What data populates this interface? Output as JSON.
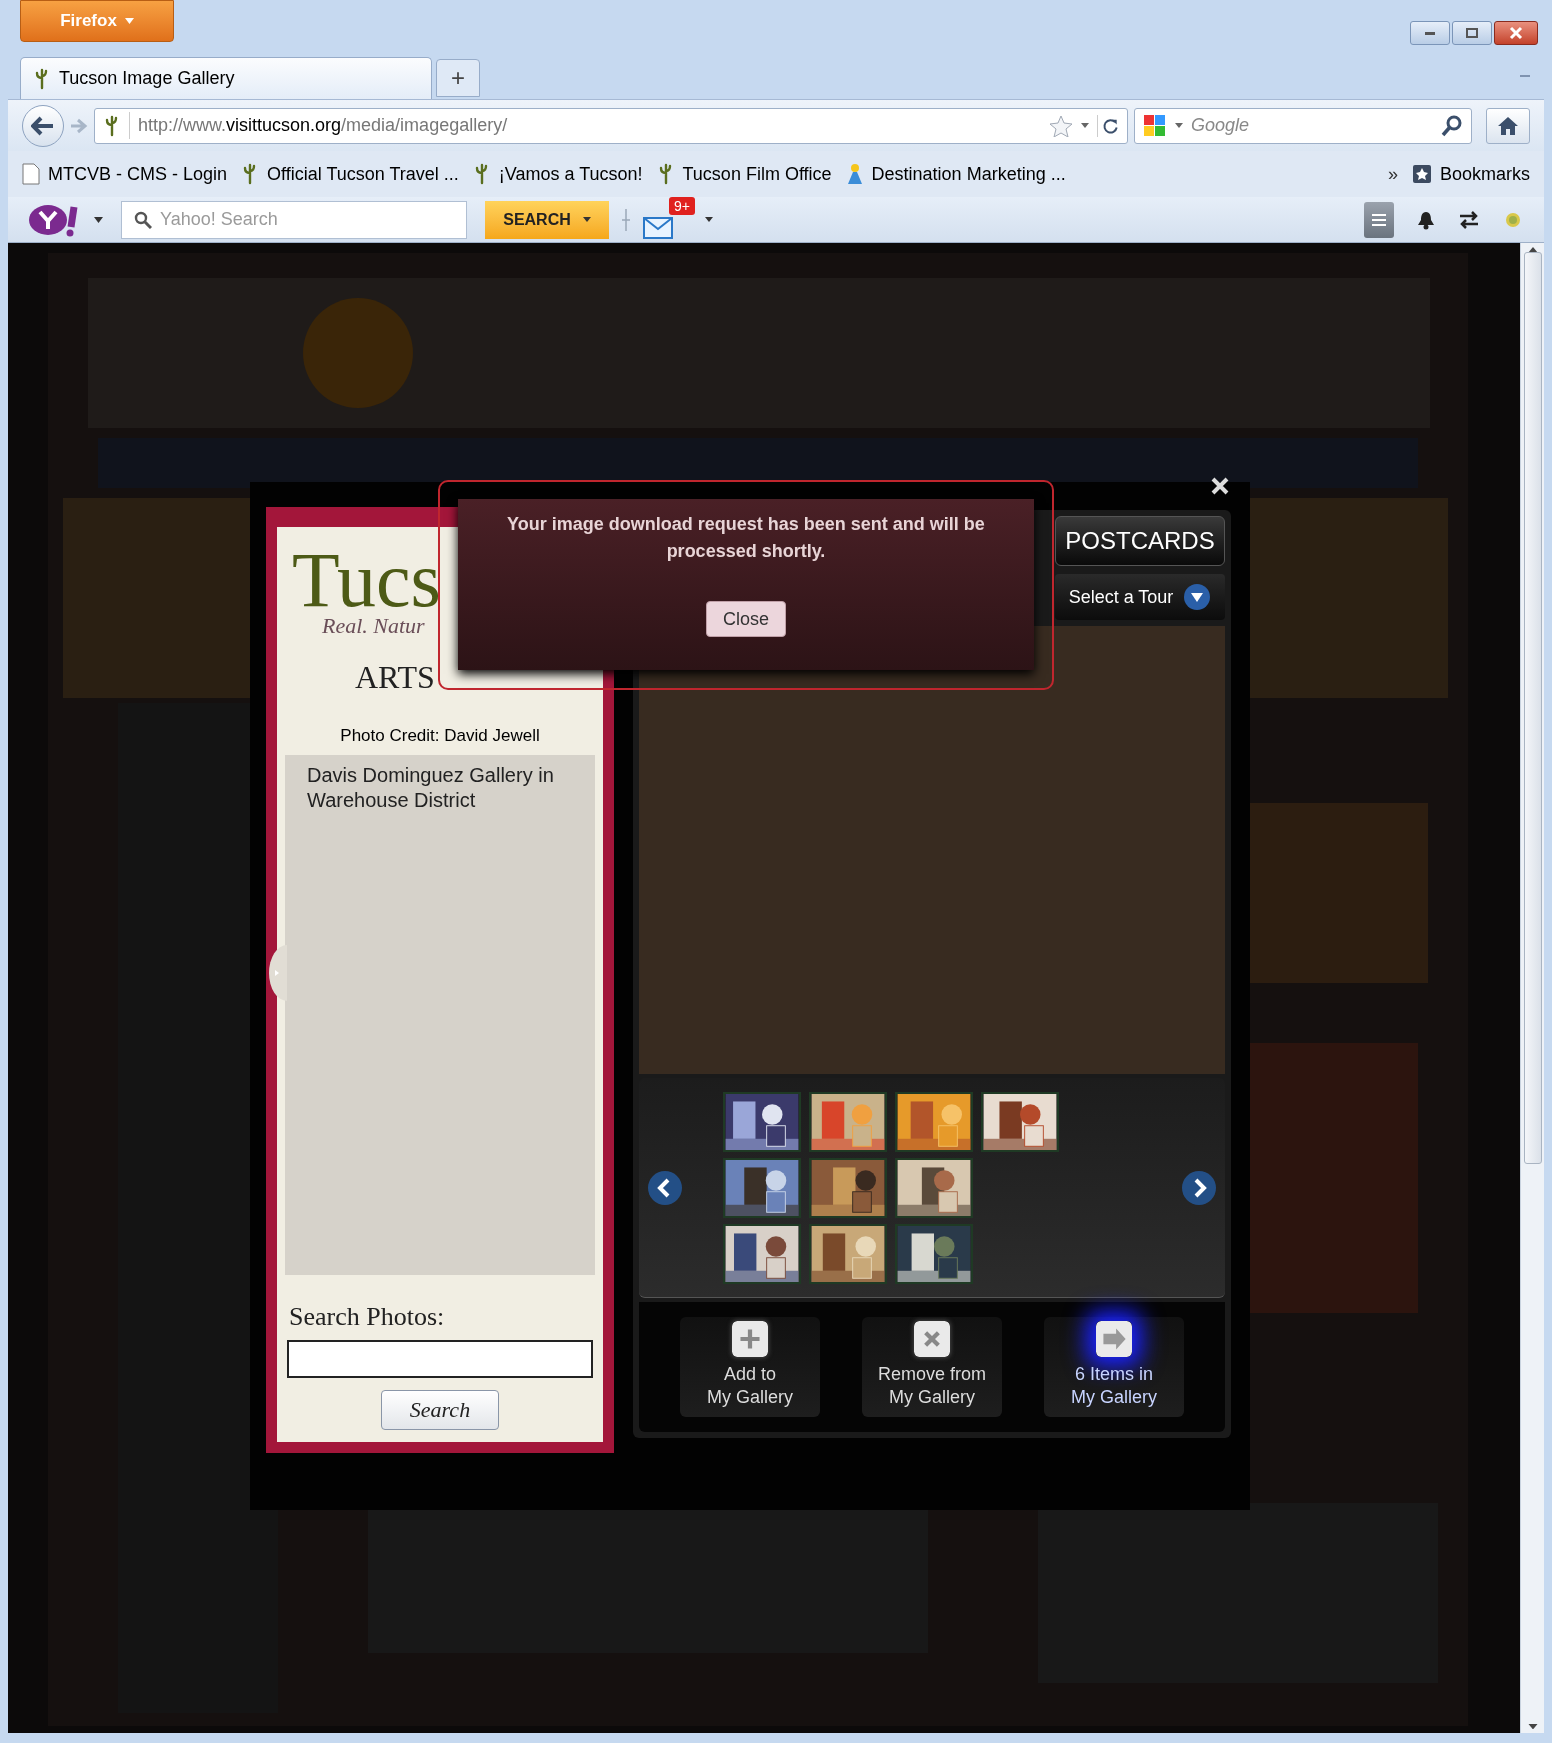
{
  "browser": {
    "menu_button": "Firefox",
    "tabs": [
      {
        "title": "Tucson Image Gallery",
        "selected": true
      }
    ],
    "new_tab": "+",
    "url": {
      "prefix": "http://www.",
      "domain": "visittucson.org",
      "path": "/media/imagegallery/"
    },
    "search_placeholder": "Google",
    "bookmarks": [
      {
        "label": "MTCVB - CMS - Login",
        "kind": "page"
      },
      {
        "label": "Official Tucson Travel ...",
        "kind": "cactus"
      },
      {
        "label": "¡Vamos a Tucson!",
        "kind": "cactus"
      },
      {
        "label": "Tucson Film Office",
        "kind": "cactus"
      },
      {
        "label": "Destination Marketing ...",
        "kind": "figure"
      }
    ],
    "overflow": "»",
    "bookmarks_menu": "Bookmarks"
  },
  "yahoo_toolbar": {
    "search_placeholder": "Yahoo! Search",
    "search_button": "SEARCH",
    "mail_badge": "9+"
  },
  "gallery": {
    "logo": "Tucs",
    "logo_tagline": "Real. Natur",
    "category": "ARTS",
    "photo_credit": "Photo Credit: David Jewell",
    "caption": "Davis Dominguez Gallery in Warehouse District",
    "search_label": "Search Photos:",
    "search_button": "Search",
    "tab": "POSTCARDS",
    "tour_select": "Select a Tour",
    "actions": [
      {
        "kind": "add",
        "label": "Add to\nMy Gallery",
        "highlighted": false
      },
      {
        "kind": "remove",
        "label": "Remove from\nMy Gallery",
        "highlighted": false
      },
      {
        "kind": "view",
        "label": "6 Items in\nMy Gallery",
        "highlighted": true
      }
    ]
  },
  "alert": {
    "message": "Your image download request has been sent and will be processed shortly.",
    "button": "Close"
  }
}
